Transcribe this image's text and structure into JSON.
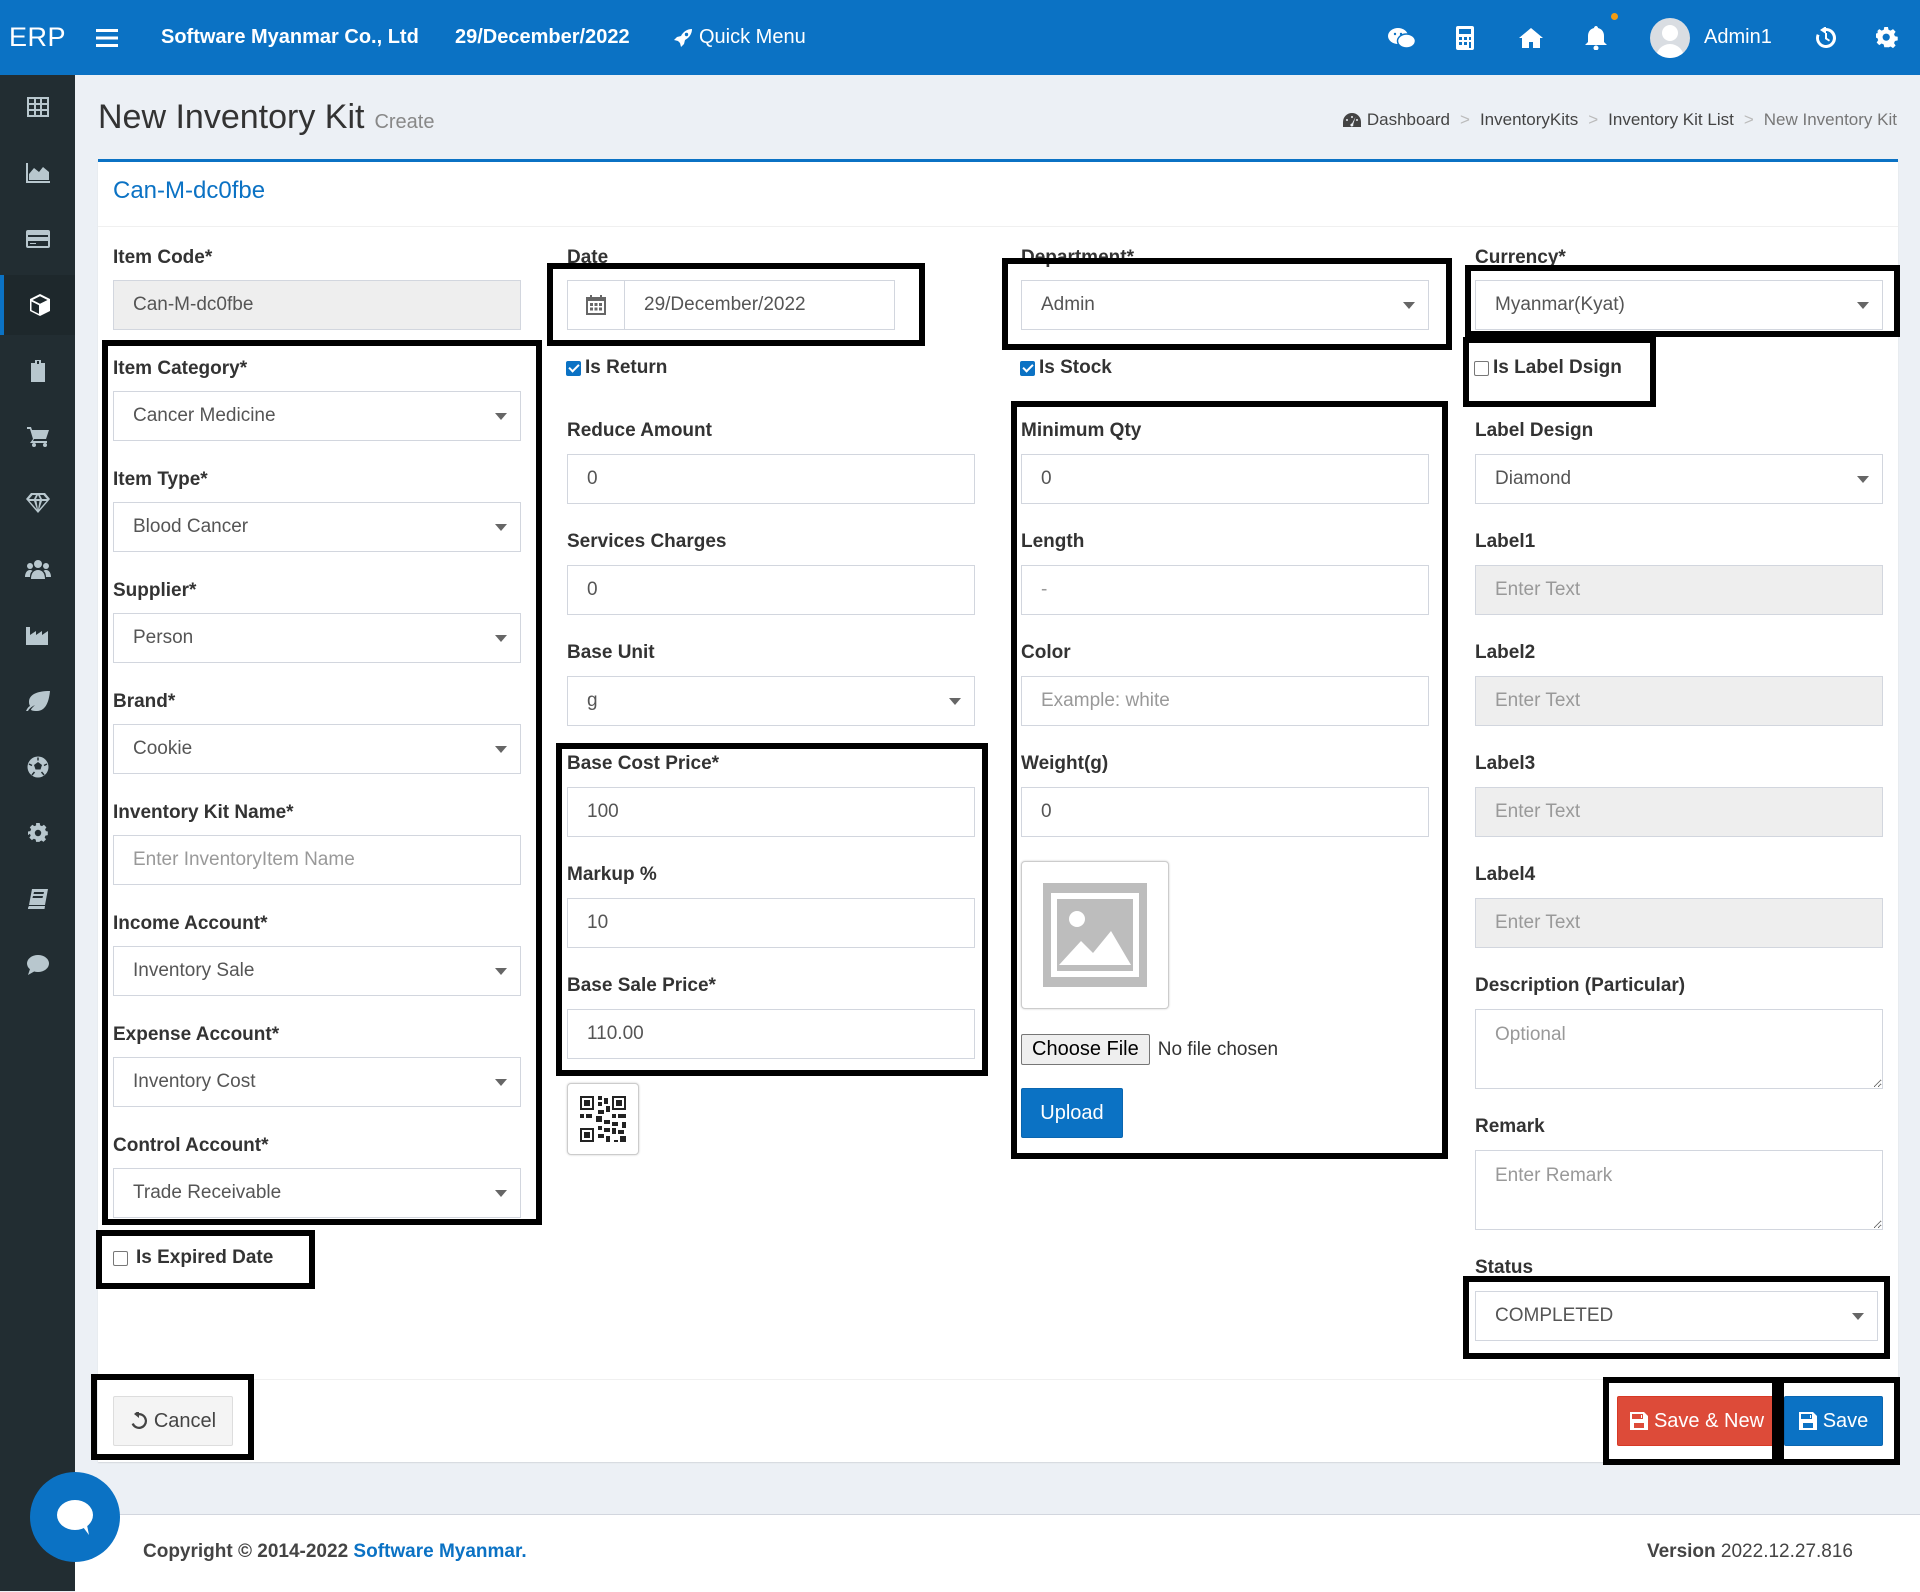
{
  "app": {
    "logo": "ERP",
    "company": "Software Myanmar Co., Ltd",
    "date": "29/December/2022",
    "quick_menu": "Quick Menu",
    "user": "Admin1"
  },
  "icons": {
    "topbar": [
      "menu-icon",
      "rocket-icon",
      "wechat-icon",
      "calculator-icon",
      "home-icon",
      "bell-icon",
      "history-icon",
      "gear-icon"
    ],
    "sidebar": [
      "table-icon",
      "area-chart-icon",
      "credit-card-icon",
      "cube-icon",
      "clipboard-icon",
      "cart-icon",
      "diamond-icon",
      "users-icon",
      "industry-icon",
      "leaf-icon",
      "soccer-ball-icon",
      "cog-icon",
      "book-icon",
      "comment-icon"
    ]
  },
  "header": {
    "title": "New Inventory Kit",
    "subtitle": "Create",
    "breadcrumb": [
      "Dashboard",
      "InventoryKits",
      "Inventory Kit List",
      "New Inventory Kit"
    ],
    "breadcrumb_sep": ">"
  },
  "form": {
    "heading": "Can-M-dc0fbe",
    "col1": {
      "item_code_label": "Item Code*",
      "item_code_value": "Can-M-dc0fbe",
      "item_category_label": "Item Category*",
      "item_category_value": "Cancer Medicine",
      "item_type_label": "Item Type*",
      "item_type_value": "Blood Cancer",
      "supplier_label": "Supplier*",
      "supplier_value": "Person",
      "brand_label": "Brand*",
      "brand_value": "Cookie",
      "kit_name_label": "Inventory Kit Name*",
      "kit_name_placeholder": "Enter InventoryItem Name",
      "income_label": "Income Account*",
      "income_value": "Inventory Sale",
      "expense_label": "Expense Account*",
      "expense_value": "Inventory Cost",
      "control_label": "Control Account*",
      "control_value": "Trade Receivable",
      "expired_label": "Is Expired Date",
      "expired_checked": false
    },
    "col2": {
      "date_label": "Date",
      "date_value": "29/December/2022",
      "is_return_label": "Is Return",
      "is_return_checked": true,
      "reduce_label": "Reduce Amount",
      "reduce_value": "0",
      "services_label": "Services Charges",
      "services_value": "0",
      "base_unit_label": "Base Unit",
      "base_unit_value": "g",
      "base_cost_label": "Base Cost Price*",
      "base_cost_value": "100",
      "markup_label": "Markup %",
      "markup_value": "10",
      "base_sale_label": "Base Sale Price*",
      "base_sale_value": "110.00"
    },
    "col3": {
      "department_label": "Department*",
      "department_value": "Admin",
      "is_stock_label": "Is Stock",
      "is_stock_checked": true,
      "min_qty_label": "Minimum Qty",
      "min_qty_value": "0",
      "length_label": "Length",
      "length_value": "-",
      "color_label": "Color",
      "color_placeholder": "Example: white",
      "weight_label": "Weight(g)",
      "weight_value": "0",
      "choose_file": "Choose File",
      "no_file": "No file chosen",
      "upload": "Upload"
    },
    "col4": {
      "currency_label": "Currency*",
      "currency_value": "Myanmar(Kyat)",
      "is_label_design_label": "Is Label Dsign",
      "is_label_design_checked": false,
      "label_design_label": "Label Design",
      "label_design_value": "Diamond",
      "label1_label": "Label1",
      "label2_label": "Label2",
      "label3_label": "Label3",
      "label4_label": "Label4",
      "label_placeholder": "Enter Text",
      "description_label": "Description (Particular)",
      "description_placeholder": "Optional",
      "remark_label": "Remark",
      "remark_placeholder": "Enter Remark",
      "status_label": "Status",
      "status_value": "COMPLETED"
    }
  },
  "actions": {
    "cancel": "Cancel",
    "save_new": "Save & New",
    "save": "Save"
  },
  "footer": {
    "copyright": "Copyright © 2014-2022",
    "brand": "Software Myanmar.",
    "version_label": "Version",
    "version": "2022.12.27.816"
  },
  "colors": {
    "primary": "#0b72c4",
    "danger": "#dd4b39",
    "sidebar": "#222d32",
    "background": "#ecf0f5"
  }
}
